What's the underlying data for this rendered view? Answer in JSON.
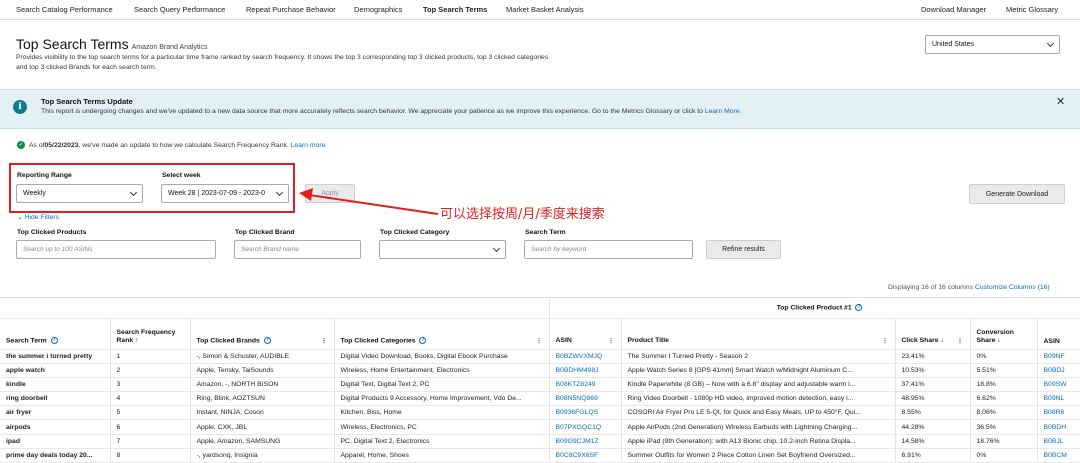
{
  "nav": {
    "tabs": [
      {
        "label": "Search Catalog Performance",
        "active": false
      },
      {
        "label": "Search Query Performance",
        "active": false
      },
      {
        "label": "Repeat Purchase Behavior",
        "active": false
      },
      {
        "label": "Demographics",
        "active": false
      },
      {
        "label": "Top Search Terms",
        "active": true
      },
      {
        "label": "Market Basket Analysis",
        "active": false
      }
    ],
    "right": [
      "Download Manager",
      "Metric Glossary"
    ]
  },
  "header": {
    "title": "Top Search Terms",
    "subtitle": "Amazon Brand Analytics",
    "description": "Provides visibility to the top search terms for a particular time frame ranked by search frequency. It shows the top 3 corresponding top 3 clicked products, top 3 clicked categories and top 3 clicked Brands for each search term.",
    "marketplace": "United States"
  },
  "banner": {
    "title": "Top Search Terms Update",
    "text": "This report is undergoing changes and we've updated to a new data source that more accurately reflects search behavior. We appreciate your patience as we improve this experience. Go to the Metrics Glossary or click to ",
    "link": "Learn More.",
    "close": "✕"
  },
  "notice": {
    "prefix": "As of ",
    "date": "05/22/2023",
    "text": ", we've made an update to how we calculate Search Frequency Rank. ",
    "link": "Learn more"
  },
  "filters": {
    "reporting_range_label": "Reporting Range",
    "reporting_range_value": "Weekly",
    "select_week_label": "Select week",
    "select_week_value": "Week 28 | 2023-07-09 - 2023-0",
    "apply": "Apply",
    "generate": "Generate Download",
    "hide_filters": "Hide Filters",
    "annotation": "可以选择按周/月/季度来搜索",
    "top_clicked_products_label": "Top Clicked Products",
    "top_clicked_products_placeholder": "Search up to 100 ASINs",
    "top_clicked_brand_label": "Top Clicked Brand",
    "top_clicked_brand_placeholder": "Search Brand name",
    "top_clicked_category_label": "Top Clicked Category",
    "search_term_label": "Search Term",
    "search_term_placeholder": "Search by keyword",
    "refine": "Refine results"
  },
  "table_meta": {
    "displaying": "Displaying 16 of 16 columns",
    "customize": "Customize Columns (16)",
    "group_header": "Top Clicked Product #1"
  },
  "columns": [
    "Search Term",
    "Search Frequency Rank",
    "Top Clicked Brands",
    "Top Clicked Categories",
    "ASIN",
    "Product Title",
    "Click Share",
    "Conversion Share",
    "ASIN"
  ],
  "rows": [
    [
      "the summer i turned pretty",
      "1",
      "-, Simon & Schuster, AUDIBLE",
      "Digital Video Download, Books, Digital Ebook Purchase",
      "B0BZWVXMJQ",
      "The Summer I Turned Pretty - Season 2",
      "23.41%",
      "0%",
      "B09NF"
    ],
    [
      "apple watch",
      "2",
      "Apple, Tensky, TaiSounds",
      "Wireless, Home Entertainment, Electronics",
      "B0BDHM498J",
      "Apple Watch Series 8 [GPS 41mm] Smart Watch w/Midnight Aluminum C...",
      "10.53%",
      "5.51%",
      "B0BDJ"
    ],
    [
      "kindle",
      "3",
      "Amazon, -, NORTH BISON",
      "Digital Text, Digital Text 2, PC",
      "B08KTZ8249",
      "Kindle Paperwhite (8 GB) – Now with a 6.8\" display and adjustable warm l...",
      "37.41%",
      "18.8%",
      "B09SW"
    ],
    [
      "ring doorbell",
      "4",
      "Ring, Blink, AOZTSUN",
      "Digital Products 9 Accessory, Home Improvement, Vdo De...",
      "B08N5NQ869",
      "Ring Video Doorbell - 1080p HD video, improved motion detection, easy i...",
      "48.95%",
      "6.62%",
      "B09NL"
    ],
    [
      "air fryer",
      "5",
      "Instant, NINJA, Cosori",
      "Kitchen, Biss, Home",
      "B0936FGLQS",
      "COSORI Air Fryer Pro LE 5-Qt, for Quick and Easy Meals, UP to 450°F, Qui...",
      "8.55%",
      "8.06%",
      "B08R6"
    ],
    [
      "airpods",
      "6",
      "Apple, CXK, JBL",
      "Wireless, Electronics, PC",
      "B07PXGQC1Q",
      "Apple AirPods (2nd Generation) Wireless Earbuds with Lightning Charging...",
      "44.28%",
      "36.5%",
      "B0BDH"
    ],
    [
      "ipad",
      "7",
      "Apple, Amazon, SAMSUNG",
      "PC, Digital Text 2, Electronics",
      "B09G9CJM1Z",
      "Apple iPad (9th Generation): with A13 Bionic chip, 10.2-inch Retina Displa...",
      "14.58%",
      "18.76%",
      "B0BJL"
    ],
    [
      "prime day deals today 20...",
      "8",
      "-, yardsonq, Insignia",
      "Apparel, Home, Shoes",
      "B0C8C9X6SF",
      "Summer Outfits for Women 2 Piece Cotton Linen Set Boyfriend Oversized...",
      "6.91%",
      "0%",
      "B0BCM"
    ]
  ],
  "colors": {
    "link": "#0a6fb6",
    "annotation": "#e11f1f",
    "banner_bg": "#e3f1f4",
    "info_icon": "#0f7c8f"
  }
}
